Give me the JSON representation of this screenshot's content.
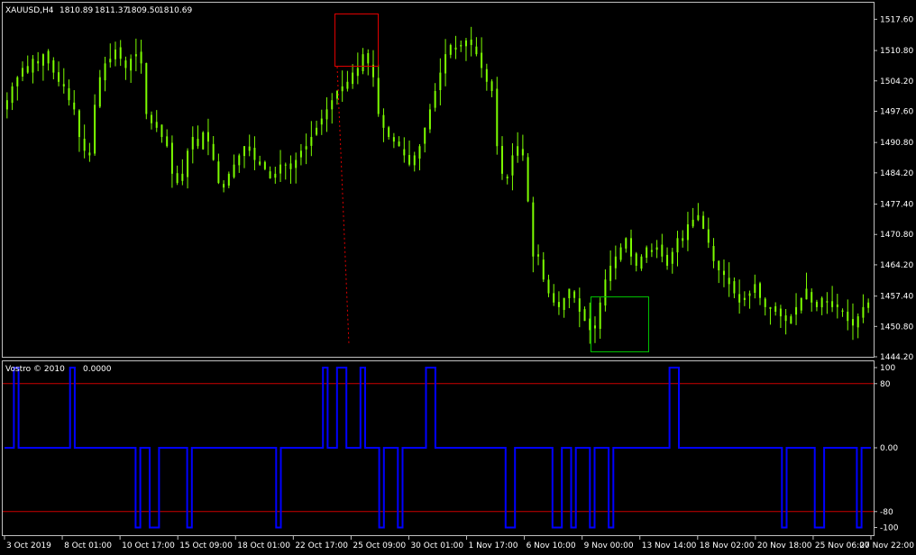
{
  "window": {
    "symbol_label": "XAUUSD,H4",
    "ohlc_values": [
      "1810.89",
      "1811.37",
      "1809.50",
      "1810.69"
    ]
  },
  "indicator": {
    "name": "Vostro © 2010",
    "value": "0.0000"
  },
  "colors": {
    "background": "#000000",
    "frame": "#c0c0c0",
    "candle_up": "#7CFC00",
    "candle_down": "#7CFC00",
    "indicator_line": "#0000ff",
    "level_line": "#cc0000",
    "highlight_sell_box": "#e00000",
    "highlight_buy_box": "#00c000",
    "text": "#ffffff"
  },
  "chart_data": [
    {
      "type": "candlestick",
      "title": "XAUUSD,H4",
      "y_ticks": [
        "1517.60",
        "1510.80",
        "1504.20",
        "1497.60",
        "1490.80",
        "1484.20",
        "1477.40",
        "1470.80",
        "1464.20",
        "1457.40",
        "1450.80",
        "1444.20"
      ],
      "ylim": [
        1444.2,
        1521.2
      ],
      "x_ticks": [
        "3 Oct 2019",
        "8 Oct 01:00",
        "10 Oct 17:00",
        "15 Oct 09:00",
        "18 Oct 01:00",
        "22 Oct 17:00",
        "25 Oct 09:00",
        "30 Oct 01:00",
        "1 Nov 17:00",
        "6 Nov 10:00",
        "9 Nov 00:00",
        "13 Nov 14:00",
        "18 Nov 02:00",
        "20 Nov 18:00",
        "25 Nov 06:00",
        "27 Nov 22:00"
      ],
      "closes": [
        1500,
        1503,
        1505,
        1507,
        1506,
        1509,
        1508,
        1510,
        1508,
        1506,
        1504,
        1503,
        1500,
        1498,
        1492,
        1489,
        1488,
        1499,
        1505,
        1508,
        1509,
        1511,
        1509,
        1507,
        1509,
        1510,
        1508,
        1497,
        1495,
        1494,
        1492,
        1490,
        1484,
        1482,
        1484,
        1489,
        1492,
        1490,
        1493,
        1491,
        1487,
        1482,
        1481,
        1484,
        1486,
        1488,
        1490,
        1489,
        1487,
        1486,
        1485,
        1483,
        1484,
        1486,
        1486,
        1485,
        1487,
        1489,
        1490,
        1492,
        1494,
        1496,
        1498,
        1500,
        1502,
        1503,
        1504,
        1506,
        1507,
        1510,
        1508,
        1505,
        1497,
        1494,
        1492,
        1491,
        1490,
        1488,
        1486,
        1488,
        1490,
        1494,
        1498,
        1502,
        1506,
        1510,
        1512,
        1511,
        1512,
        1513,
        1512,
        1510,
        1507,
        1504,
        1502,
        1490,
        1484,
        1483,
        1488,
        1490,
        1488,
        1478,
        1466,
        1466,
        1461,
        1458,
        1456,
        1455,
        1457,
        1459,
        1457,
        1454,
        1452,
        1450,
        1451,
        1456,
        1461,
        1464,
        1466,
        1468,
        1470,
        1466,
        1464,
        1466,
        1468,
        1467,
        1468,
        1466,
        1464,
        1467,
        1470,
        1470,
        1473,
        1474,
        1475,
        1472,
        1469,
        1465,
        1463,
        1462,
        1460,
        1458,
        1456,
        1457,
        1458,
        1460,
        1457,
        1455,
        1455,
        1454,
        1453,
        1452,
        1453,
        1455,
        1457,
        1459,
        1456,
        1455,
        1457,
        1456,
        1455,
        1455,
        1454,
        1452,
        1451,
        1453,
        1455,
        1456
      ]
    },
    {
      "type": "line",
      "title": "Vostro © 2010",
      "y_ticks": [
        "100",
        "80",
        "0.00",
        "-80",
        "-100"
      ],
      "levels": [
        80,
        -80
      ],
      "ylim": [
        -100,
        100
      ],
      "series": [
        {
          "values": [
            0,
            0,
            100,
            0,
            0,
            0,
            0,
            0,
            0,
            0,
            0,
            0,
            0,
            0,
            100,
            0,
            0,
            0,
            0,
            0,
            0,
            0,
            0,
            0,
            0,
            0,
            0,
            0,
            -100,
            0,
            0,
            -100,
            -100,
            0,
            0,
            0,
            0,
            0,
            0,
            -100,
            0,
            0,
            0,
            0,
            0,
            0,
            0,
            0,
            0,
            0,
            0,
            0,
            0,
            0,
            0,
            0,
            0,
            0,
            -100,
            0,
            0,
            0,
            0,
            0,
            0,
            0,
            0,
            0,
            100,
            0,
            0,
            100,
            100,
            0,
            0,
            0,
            100,
            0,
            0,
            0,
            -100,
            0,
            0,
            0,
            -100,
            0,
            0,
            0,
            0,
            0,
            100,
            100,
            0,
            0,
            0,
            0,
            0,
            0,
            0,
            0,
            0,
            0,
            0,
            0,
            0,
            0,
            0,
            -100,
            -100,
            0,
            0,
            0,
            0,
            0,
            0,
            0,
            0,
            -100,
            -100,
            0,
            0,
            -100,
            0,
            0,
            0,
            -100,
            0,
            0,
            0,
            -100,
            0,
            0,
            0,
            0,
            0,
            0,
            0,
            0,
            0,
            0,
            0,
            0,
            100,
            100,
            0,
            0,
            0,
            0,
            0,
            0,
            0,
            0,
            0,
            0,
            0,
            0,
            0,
            0,
            0,
            0,
            0,
            0,
            0,
            0,
            0,
            0,
            -100,
            0,
            0,
            0,
            0,
            0,
            0,
            -100,
            -100,
            0,
            0,
            0,
            0,
            0,
            0,
            0,
            -100,
            0,
            0
          ]
        }
      ]
    }
  ]
}
